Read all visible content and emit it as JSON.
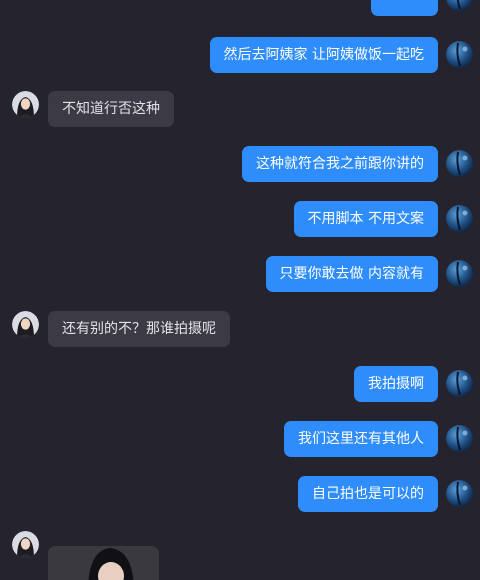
{
  "chat": {
    "messages": [
      {
        "side": "out",
        "text": ""
      },
      {
        "side": "out",
        "text": "然后去阿姨家  让阿姨做饭一起吃"
      },
      {
        "side": "in",
        "text": "不知道行否这种"
      },
      {
        "side": "out",
        "text": "这种就符合我之前跟你讲的"
      },
      {
        "side": "out",
        "text": "不用脚本  不用文案"
      },
      {
        "side": "out",
        "text": "只要你敢去做  内容就有"
      },
      {
        "side": "in",
        "text": "还有别的不？那谁拍摄呢"
      },
      {
        "side": "out",
        "text": "我拍摄啊"
      },
      {
        "side": "out",
        "text": "我们这里还有其他人"
      },
      {
        "side": "out",
        "text": "自己拍也是可以的"
      }
    ],
    "image_message": {
      "side": "in"
    }
  },
  "icons": {
    "self_avatar": "blue-sphere-avatar-icon",
    "contact_avatar": "woman-portrait-avatar-icon"
  },
  "colors": {
    "background": "#24232e",
    "outgoing_bubble": "#2e8dfb",
    "incoming_bubble": "#3b3a45"
  }
}
